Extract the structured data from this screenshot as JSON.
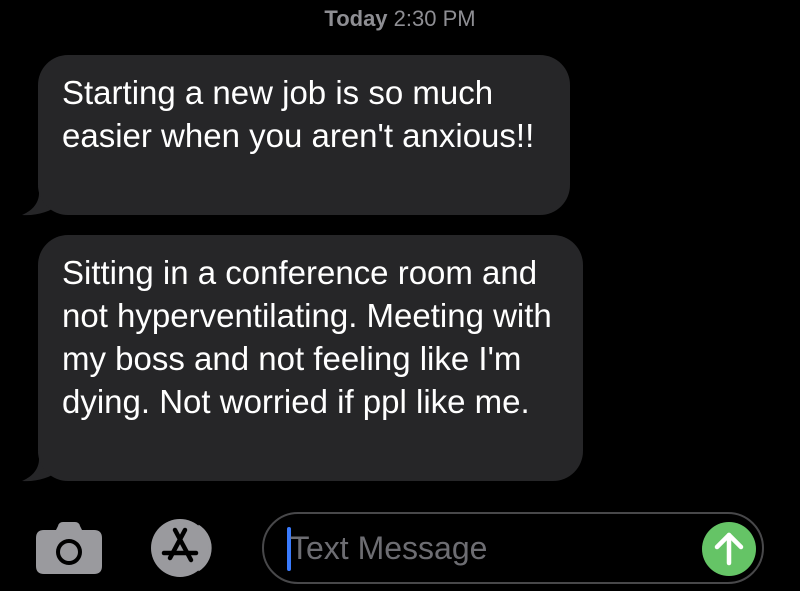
{
  "header": {
    "timestamp_day": "Today",
    "timestamp_time": "2:30 PM"
  },
  "messages": [
    {
      "text": "Starting a new job is so much easier when you aren't anxious!!"
    },
    {
      "text": "Sitting in a conference room and not hyperventilating. Meeting with my boss and not feeling like I'm dying. Not worried if ppl like me."
    }
  ],
  "composer": {
    "placeholder": "Text Message",
    "camera_icon": "camera-icon",
    "appstore_icon": "app-store-icon",
    "send_icon": "arrow-up-icon"
  },
  "colors": {
    "background": "#000000",
    "bubble": "#262628",
    "timestamp": "#8e8e93",
    "send": "#65c466",
    "caret": "#3a7bfd",
    "icon_gray": "#9a9a9e"
  }
}
